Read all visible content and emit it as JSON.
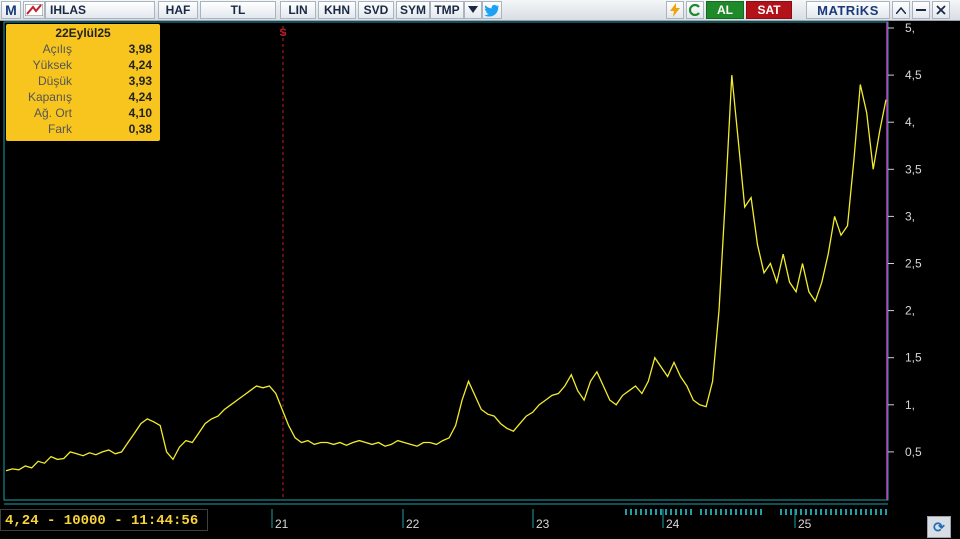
{
  "toolbar": {
    "logo": "M",
    "symbol": "IHLAS",
    "buttons": [
      "HAF",
      "TL",
      "LIN",
      "KHN",
      "SVD",
      "SYM",
      "TMP"
    ],
    "al": "AL",
    "sat": "SAT",
    "brand": "MATRiKS"
  },
  "info": {
    "date": "22Eylül25",
    "rows": [
      {
        "label": "Açılış",
        "value": "3,98"
      },
      {
        "label": "Yüksek",
        "value": "4,24"
      },
      {
        "label": "Düşük",
        "value": "3,93"
      },
      {
        "label": "Kapanış",
        "value": "4,24"
      },
      {
        "label": "Ağ. Ort",
        "value": "4,10"
      },
      {
        "label": "Fark",
        "value": "0,38"
      }
    ]
  },
  "status": "4,24 - 10000 - 11:44:56",
  "marker_label": "S",
  "colors": {
    "line": "#f2ec2c",
    "axis": "#cfcfcf",
    "marker": "#c0202a",
    "cursor": "#c040c0",
    "frame": "#1ea0a8"
  },
  "chart_data": {
    "type": "line",
    "y_ticks": [
      "0,5",
      "1,",
      "1,5",
      "2,",
      "2,5",
      "3,",
      "3,5",
      "4,",
      "4,5",
      "5,"
    ],
    "y_values": [
      0.5,
      1,
      1.5,
      2,
      2.5,
      3,
      3.5,
      4,
      4.5,
      5
    ],
    "ylim": [
      0,
      5
    ],
    "x_labels": [
      "21",
      "22",
      "23",
      "24",
      "25"
    ],
    "series": [
      {
        "values": [
          0.3,
          0.32,
          0.31,
          0.35,
          0.33,
          0.4,
          0.38,
          0.45,
          0.42,
          0.43,
          0.5,
          0.48,
          0.46,
          0.49,
          0.47,
          0.5,
          0.52,
          0.48,
          0.5,
          0.6,
          0.7,
          0.8,
          0.85,
          0.82,
          0.78,
          0.5,
          0.42,
          0.55,
          0.62,
          0.6,
          0.7,
          0.8,
          0.85,
          0.88,
          0.95,
          1.0,
          1.05,
          1.1,
          1.15,
          1.2,
          1.18,
          1.2,
          1.12,
          0.95,
          0.78,
          0.65,
          0.6,
          0.62,
          0.58,
          0.6,
          0.6,
          0.58,
          0.6,
          0.57,
          0.6,
          0.62,
          0.6,
          0.58,
          0.6,
          0.56,
          0.58,
          0.62,
          0.6,
          0.58,
          0.56,
          0.6,
          0.6,
          0.58,
          0.62,
          0.65,
          0.78,
          1.05,
          1.25,
          1.1,
          0.95,
          0.9,
          0.88,
          0.8,
          0.75,
          0.72,
          0.8,
          0.88,
          0.92,
          1.0,
          1.05,
          1.1,
          1.12,
          1.2,
          1.32,
          1.15,
          1.05,
          1.25,
          1.35,
          1.2,
          1.05,
          1.0,
          1.1,
          1.15,
          1.2,
          1.12,
          1.25,
          1.5,
          1.4,
          1.3,
          1.45,
          1.3,
          1.2,
          1.05,
          1.0,
          0.98,
          1.25,
          2.0,
          3.2,
          4.5,
          3.8,
          3.1,
          3.2,
          2.7,
          2.4,
          2.5,
          2.3,
          2.6,
          2.3,
          2.2,
          2.5,
          2.2,
          2.1,
          2.3,
          2.6,
          3.0,
          2.8,
          2.9,
          3.6,
          4.4,
          4.1,
          3.5,
          3.9,
          4.24
        ]
      }
    ]
  }
}
